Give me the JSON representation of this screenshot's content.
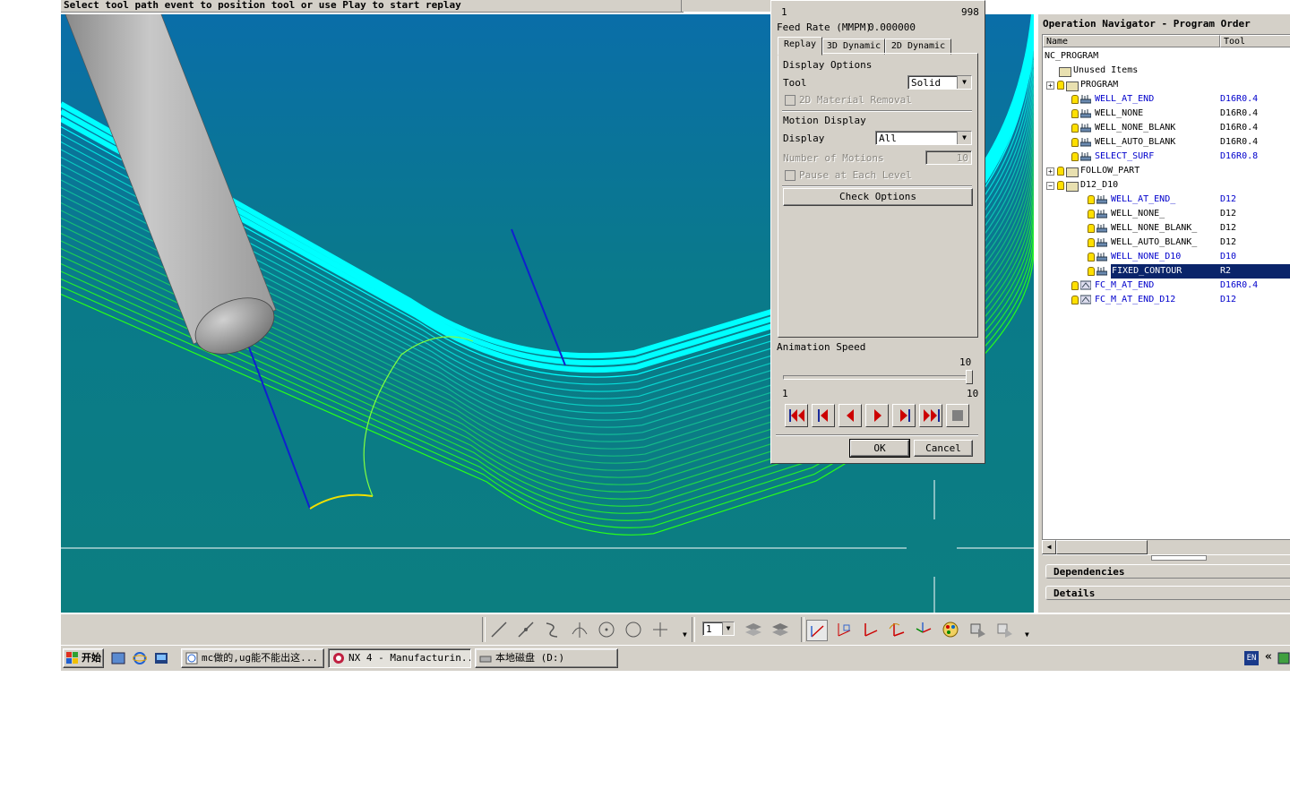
{
  "status_bar": {
    "message": "Select tool path event to position tool or use Play to start replay"
  },
  "replay_dialog": {
    "counter_min": "1",
    "counter_max": "998",
    "feed_rate_label": "Feed Rate (MMPM)",
    "feed_rate_value": "0.000000",
    "tabs": [
      {
        "label": "Replay",
        "active": true
      },
      {
        "label": "3D Dynamic",
        "active": false
      },
      {
        "label": "2D Dynamic",
        "active": false
      }
    ],
    "display_options_label": "Display Options",
    "tool_label": "Tool",
    "tool_value": "Solid",
    "material_removal_label": "2D Material Removal",
    "motion_display_label": "Motion Display",
    "display_label": "Display",
    "display_value": "All",
    "number_of_motions_label": "Number of Motions",
    "number_of_motions_value": "10",
    "pause_label": "Pause at Each Level",
    "check_options_label": "Check Options",
    "animation_speed_label": "Animation Speed",
    "speed_value": "10",
    "speed_min": "1",
    "speed_max": "10",
    "ok_label": "OK",
    "cancel_label": "Cancel"
  },
  "navigator": {
    "title": "Operation Navigator - Program Order",
    "col_name": "Name",
    "col_tool": "Tool",
    "rows": [
      {
        "name": "NC_PROGRAM",
        "tool": ""
      },
      {
        "name": "Unused Items",
        "tool": ""
      },
      {
        "name": "PROGRAM",
        "tool": ""
      },
      {
        "name": "WELL_AT_END",
        "tool": "D16R0.4"
      },
      {
        "name": "WELL_NONE",
        "tool": "D16R0.4"
      },
      {
        "name": "WELL_NONE_BLANK",
        "tool": "D16R0.4"
      },
      {
        "name": "WELL_AUTO_BLANK",
        "tool": "D16R0.4"
      },
      {
        "name": "SELECT_SURF",
        "tool": "D16R0.8"
      },
      {
        "name": "FOLLOW_PART",
        "tool": ""
      },
      {
        "name": "D12_D10",
        "tool": ""
      },
      {
        "name": "WELL_AT_END_",
        "tool": "D12"
      },
      {
        "name": "WELL_NONE_",
        "tool": "D12"
      },
      {
        "name": "WELL_NONE_BLANK_",
        "tool": "D12"
      },
      {
        "name": "WELL_AUTO_BLANK_",
        "tool": "D12"
      },
      {
        "name": "WELL_NONE_D10",
        "tool": "D10"
      },
      {
        "name": "FIXED_CONTOUR",
        "tool": "R2"
      },
      {
        "name": "FC_M_AT_END",
        "tool": "D16R0.4"
      },
      {
        "name": "FC_M_AT_END_D12",
        "tool": "D12"
      }
    ],
    "dependencies_label": "Dependencies",
    "details_label": "Details"
  },
  "toolbar": {
    "layer_value": "1"
  },
  "taskbar": {
    "start_label": "开始",
    "tasks": [
      {
        "label": "mc做的,ug能不能出这..."
      },
      {
        "label": "NX 4 - Manufacturin..."
      },
      {
        "label": "本地磁盘 (D:)"
      }
    ],
    "lang": "EN",
    "chevron": "«"
  },
  "colors": {
    "viewport_bg": "#0a7c84",
    "toolpath_cyan": "#00ffff",
    "toolpath_green": "#00c000",
    "dialog_bg": "#d4d0c8",
    "selection": "#0a246a",
    "link_blue": "#0000cc"
  }
}
